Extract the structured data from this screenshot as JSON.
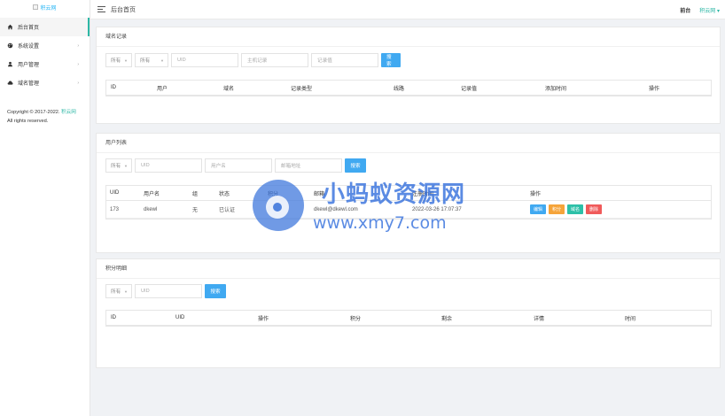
{
  "logo": {
    "alt": "积云网"
  },
  "sidebar": {
    "items": [
      {
        "label": "后台首页",
        "icon": "home-icon",
        "active": true,
        "has_submenu": false
      },
      {
        "label": "系统设置",
        "icon": "palette-icon",
        "active": false,
        "has_submenu": true
      },
      {
        "label": "用户管理",
        "icon": "user-icon",
        "active": false,
        "has_submenu": true
      },
      {
        "label": "域名管理",
        "icon": "cloud-icon",
        "active": false,
        "has_submenu": true
      }
    ],
    "copyright_prefix": "Copyright © 2017-2022.",
    "copyright_link": "积云网",
    "copyright_suffix": "All rights reserved."
  },
  "header": {
    "title": "后台首页",
    "front_link": "前台",
    "user_name": "积云网",
    "user_caret": "▾"
  },
  "records": {
    "title": "域名记录",
    "filter": {
      "select1": "所有",
      "select2": "所有",
      "uid_placeholder": "UID",
      "domain_placeholder": "主机记录",
      "record_placeholder": "记录值",
      "search_button": "搜索"
    },
    "columns": [
      "ID",
      "用户",
      "域名",
      "记录类型",
      "线路",
      "记录值",
      "添加时间",
      "操作"
    ]
  },
  "users": {
    "title": "用户列表",
    "filter": {
      "select1": "所有",
      "uid_placeholder": "UID",
      "username_placeholder": "用户名",
      "email_placeholder": "邮箱地址",
      "search_button": "搜索"
    },
    "columns": [
      "UID",
      "用户名",
      "组",
      "状态",
      "积分",
      "邮箱",
      "注册时间",
      "操作"
    ],
    "rows": [
      {
        "uid": "173",
        "username": "dkewl",
        "group": "无",
        "status": "已认证",
        "points": "0",
        "email": "dkewl@dkewl.com",
        "reg_time": "2022-03-26 17:07:37"
      }
    ],
    "actions": [
      {
        "label": "编辑",
        "color": "#40a9f1"
      },
      {
        "label": "积分",
        "color": "#f5a43a"
      },
      {
        "label": "域名",
        "color": "#2dc0a8"
      },
      {
        "label": "删除",
        "color": "#f05a5a"
      }
    ]
  },
  "points": {
    "title": "积分明细",
    "filter": {
      "select1": "所有",
      "uid_placeholder": "UID",
      "search_button": "搜索"
    },
    "columns": [
      "ID",
      "UID",
      "操作",
      "积分",
      "剩余",
      "详情",
      "时间"
    ]
  },
  "watermark": {
    "cn_text": "小蚂蚁资源网",
    "url_text": "www.xmy7.com"
  },
  "colors": {
    "accent": "#2db7a5",
    "primary_button": "#40a9f1"
  }
}
